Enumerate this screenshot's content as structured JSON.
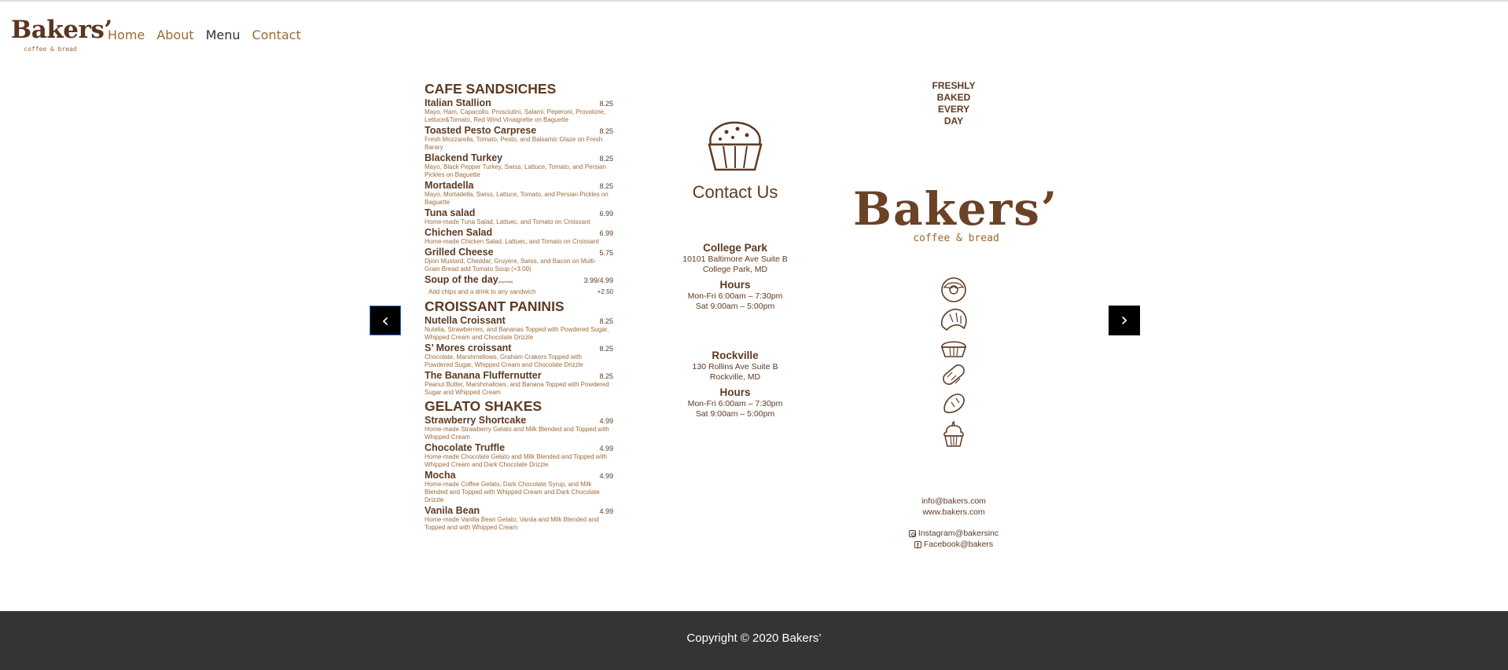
{
  "nav": {
    "brand_name": "Bakers’",
    "brand_sub": "coffee & bread",
    "links": [
      {
        "label": "Home",
        "active": false
      },
      {
        "label": "About",
        "active": false
      },
      {
        "label": "Menu",
        "active": true
      },
      {
        "label": "Contact",
        "active": false
      }
    ]
  },
  "carousel": {
    "prev_label": "‹",
    "next_label": "›"
  },
  "menu": {
    "sections": [
      {
        "title": "CAFE SANDSICHES",
        "items": [
          {
            "name": "Italian Stallion",
            "price": "8.25",
            "desc": "Mayo, Ham, Capacollo, Prosciutini, Salami, Peperoni, Provolone, Lettuce&Tomato, Red Wind Vinaigrette on Baguette"
          },
          {
            "name": "Toasted Pesto Carprese",
            "price": "8.25",
            "desc": "Fresh Mozzarella, Tomato, Pesto, and Balsamic Glaze on Fresh Barary"
          },
          {
            "name": "Blackend Turkey",
            "price": "8.25",
            "desc": "Mayo, Black Pepper Turkey, Swiss, Lattuce, Tomato, and Persian Pickles on Baguette"
          },
          {
            "name": "Mortadella",
            "price": "8.25",
            "desc": "Mayo, Mortadella, Swiss, Lattuce, Tomato, and Persian Pickles on Baguette"
          },
          {
            "name": "Tuna salad",
            "price": "6.99",
            "desc": "Home-made Tuna Salad, Lattuec, and Tomato on Croissant"
          },
          {
            "name": "Chichen Salad",
            "price": "6.99",
            "desc": "Home-made Chicken Salad, Lattuec, and Tomato on  Croissant"
          },
          {
            "name": "Grilled Cheese",
            "price": "5.75",
            "desc": "Djion Mustard, Cheddar, Gruyere, Swiss, and Bacon on Multi-Grain Bread add Tomato Soup (+3.00)"
          }
        ],
        "soup": {
          "name": "Soup of the day",
          "small": "(cup/bowl)",
          "price": "3.99/4.99",
          "note": "Add chips and a drink to any sandwich",
          "note_price": "+2.50"
        }
      },
      {
        "title": "CROISSANT PANINIS",
        "items": [
          {
            "name": "Nutella Croissant",
            "price": "8.25",
            "desc": "Nutella, Strawberries, and Bananas Topped with Powdered Sugar, Whipped Cream and Chocolate Drizzle"
          },
          {
            "name": "S’ Mores croissant",
            "price": "8.25",
            "desc": "Chocolate, Marshmellows, Graham Crakers Topped with Powdered Sugar, Whipped Cream and Chocolate Drizzle"
          },
          {
            "name": "The Banana Fluffernutter",
            "price": "8.25",
            "desc": "Peanut Butter, Marshmallows, and Banana Topped with Powdered Sugar and Whipped Cream"
          }
        ]
      },
      {
        "title": "GELATO SHAKES",
        "items": [
          {
            "name": "Strawberry Shortcake",
            "price": "4.99",
            "desc": "Home-made Strawberry Gelato and Milk Blended and Topped with Whipped Cream"
          },
          {
            "name": "Chocolate Truffle",
            "price": "4.99",
            "desc": "Home-made Chocolate Gelato and Milk Blended and Topped with Whipped Cream and Dark Chocolate Drizzle"
          },
          {
            "name": "Mocha",
            "price": "4.99",
            "desc": "Home-made Coffee Gelato, Dark Chocolate Syrup, and  Milk Blended and Topped with Whipped Cream and Dark Chocolate Drizzle"
          },
          {
            "name": "Vanila Bean",
            "price": "4.99",
            "desc": "Home-made Vanilla Bean Gelato, Vanila  and  Milk Blended and Topped and with Whipped Cream"
          }
        ]
      }
    ]
  },
  "contact": {
    "title": "Contact Us",
    "locations": [
      {
        "name": "College Park",
        "address1": "10101 Baltimore Ave Suite B",
        "address2": "College Park, MD",
        "hours_title": "Hours",
        "hours1": "Mon-Fri 6:00am – 7:30pm",
        "hours2": "Sat 9:00am – 5:00pm"
      },
      {
        "name": "Rockville",
        "address1": "130 Rollins Ave Suite B",
        "address2": "Rockville, MD",
        "hours_title": "Hours",
        "hours1": "Mon-Fri 6:00am – 7:30pm",
        "hours2": "Sat 9:00am – 5:00pm"
      }
    ]
  },
  "promo": {
    "fresh_lines": [
      "FRESHLY",
      "BAKED",
      "EVERY",
      "DAY"
    ],
    "brand_name": "Bakers’",
    "brand_sub": "coffee & bread",
    "icons": [
      "donut-icon",
      "croissant-icon",
      "muffin-icon",
      "baguette-icon",
      "bread-roll-icon",
      "cupcake-icon"
    ],
    "email": "info@bakers.com",
    "website": "www.bakers.com",
    "instagram": "Instagram@bakersinc",
    "facebook": "Facebook@bakers"
  },
  "footer": {
    "copyright": "Copyright © 2020 Bakers’"
  },
  "colors": {
    "brand_brown": "#5e3a22",
    "accent_tan": "#a06a3a",
    "nav_link": "#9c6b30",
    "footer_bg": "#343434"
  }
}
